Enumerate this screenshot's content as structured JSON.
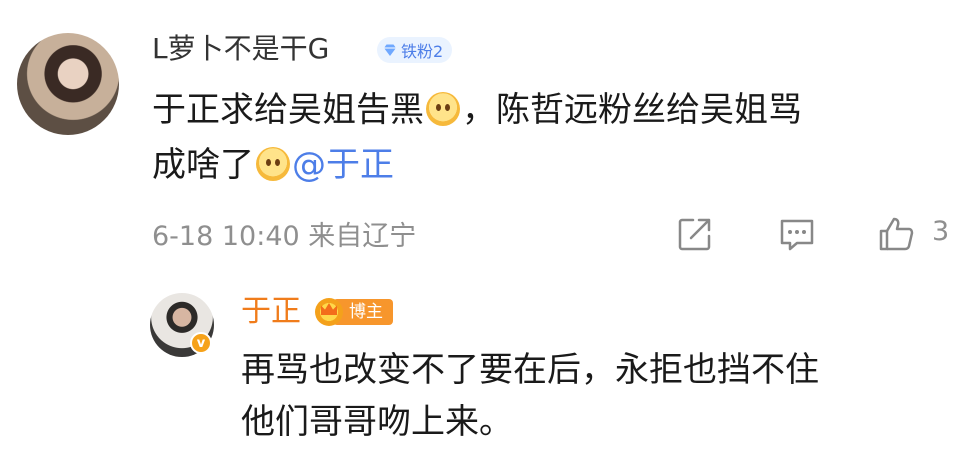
{
  "comment": {
    "username": "L萝卜不是干G",
    "fan_badge": "铁粉2",
    "text_line1_part1": "于正求给吴姐告黑",
    "text_line1_part2": "，陈哲远粉丝给吴姐骂",
    "text_line2_part1": "成啥了",
    "mention": "@于正",
    "date": "6-18 10:40",
    "location": "来自辽宁",
    "like_count": "3"
  },
  "reply": {
    "username": "于正",
    "host_badge": "博主",
    "verified_mark": "v",
    "text_line1": "再骂也改变不了要在后，永拒也挡不住",
    "text_line2": "他们哥哥吻上来。"
  },
  "icons": {
    "share": "share-icon",
    "comment": "comment-icon",
    "like": "thumbs-up-icon",
    "fan": "diamond-icon",
    "host": "crown-icon"
  },
  "colors": {
    "mention": "#4d7ee8",
    "reply_name": "#f07c1b",
    "meta": "#8f8f8f",
    "host_badge": "#f7962c",
    "fan_badge_bg": "#eaf3ff"
  }
}
